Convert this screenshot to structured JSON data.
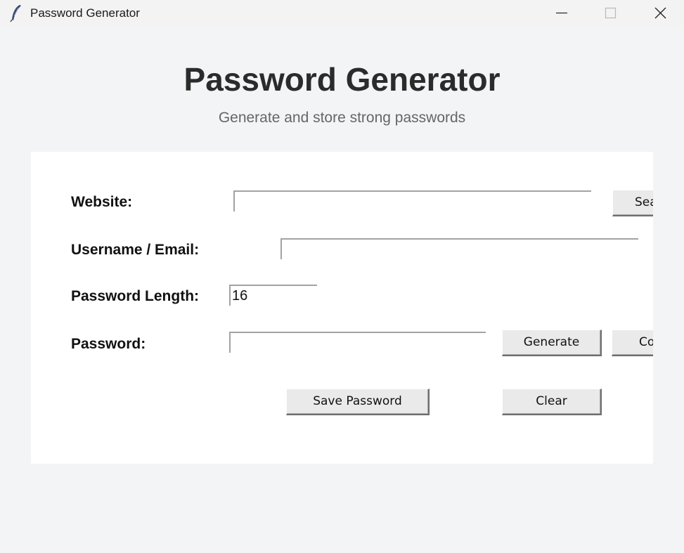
{
  "window": {
    "title": "Password Generator",
    "controls": {
      "minimize": "minimize-icon",
      "maximize": "maximize-icon",
      "close": "close-icon"
    }
  },
  "header": {
    "title": "Password Generator",
    "subtitle": "Generate and store strong passwords"
  },
  "form": {
    "website": {
      "label": "Website:",
      "value": "",
      "button": "Sea"
    },
    "username": {
      "label": "Username / Email:",
      "value": ""
    },
    "length": {
      "label": "Password Length:",
      "value": "16"
    },
    "password": {
      "label": "Password:",
      "value": "",
      "generate_button": "Generate",
      "copy_button": "Co"
    }
  },
  "actions": {
    "save_label": "Save Password",
    "clear_label": "Clear"
  },
  "colors": {
    "window_bg": "#f3f4f6",
    "card_bg": "#ffffff",
    "button_bg": "#eaeaea",
    "title_text": "#2b2b2b",
    "subtitle_text": "#666666"
  }
}
